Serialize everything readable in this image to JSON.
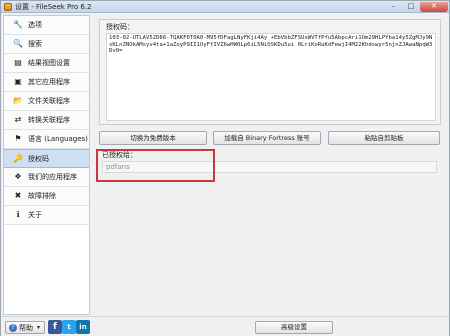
{
  "window": {
    "title": "设置 - FileSeek Pro 6.2",
    "minimize_glyph": "–",
    "maximize_glyph": "□",
    "close_glyph": "✕"
  },
  "sidebar": {
    "items": [
      {
        "label": "选项",
        "icon": "wrench-icon",
        "glyph": "🔧"
      },
      {
        "label": "搜索",
        "icon": "magnifier-icon",
        "glyph": "🔍"
      },
      {
        "label": "结果视图设置",
        "icon": "grid-icon",
        "glyph": "▤"
      },
      {
        "label": "其它应用程序",
        "icon": "window-icon",
        "glyph": "▣"
      },
      {
        "label": "文件关联程序",
        "icon": "folder-icon",
        "glyph": "📂"
      },
      {
        "label": "转换关联程序",
        "icon": "convert-icon",
        "glyph": "⇄"
      },
      {
        "label": "语言 (Languages)",
        "icon": "flag-icon",
        "glyph": "⚑"
      },
      {
        "label": "授权码",
        "icon": "key-icon",
        "glyph": "🔑"
      },
      {
        "label": "我们的应用程序",
        "icon": "apps-icon",
        "glyph": "❖"
      },
      {
        "label": "故障排除",
        "icon": "tools-icon",
        "glyph": "✖"
      },
      {
        "label": "关于",
        "icon": "info-icon",
        "glyph": "ℹ"
      }
    ],
    "active_index": 7
  },
  "license": {
    "label": "授权码：",
    "code": "103-02-UTLAV52D66-TQAKF0T0A0-M95fDFagLNyFKji4Ay +EbVbbZFSUxWVTfPfu5AbpcAri1Om29HLPYba14y5ZgMJy9NsKLnZNOkAMsyv4ta+1aZoyP9II1OyFfIVZ6wHW0Lp6iL5NiOSKDu5ui 0LriKoRuKdFewjI4M22Khdswyr5njnZJAwaNpqW3Dv0="
  },
  "buttons": {
    "free_version": "切换为免费版本",
    "binary_fortress": "加载自 Binary Fortress 账号",
    "paste": "粘贴自剪贴板"
  },
  "authorized": {
    "label": "已授权给：",
    "value": "pdfans"
  },
  "bottom": {
    "help_label": "帮助",
    "help_caret": "▾",
    "facebook": "f",
    "twitter": "t",
    "linkedin": "in",
    "advanced": "高级设置"
  },
  "colors": {
    "highlight_box": "#c9363b",
    "active_nav": "#cfdff3"
  }
}
